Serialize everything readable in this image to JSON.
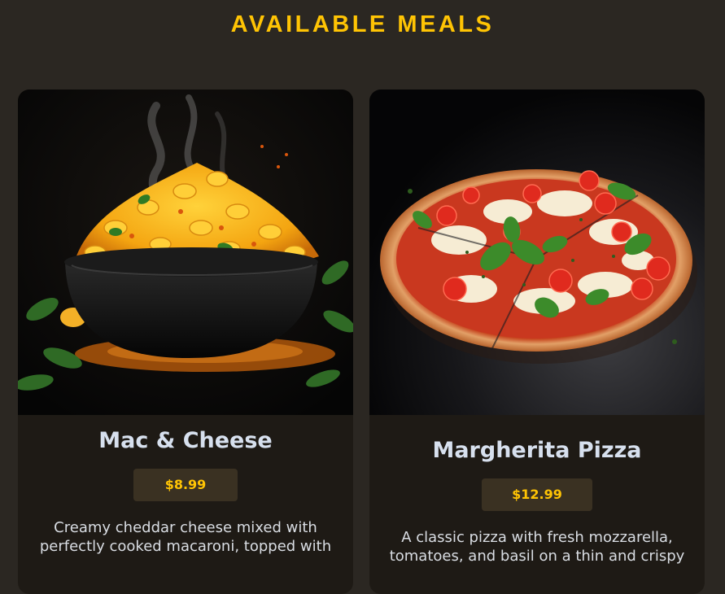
{
  "page": {
    "title": "AVAILABLE MEALS"
  },
  "meals": [
    {
      "name": "Mac & Cheese",
      "price": "$8.99",
      "description": "Creamy cheddar cheese mixed with perfectly cooked macaroni, topped with"
    },
    {
      "name": "Margherita Pizza",
      "price": "$12.99",
      "description": "A classic pizza with fresh mozzarella, tomatoes, and basil on a thin and crispy"
    }
  ],
  "colors": {
    "background": "#2b2722",
    "card": "#1e1a15",
    "accent": "#ffc404",
    "price_badge": "#3a3122",
    "heading_text": "#d7e0ee"
  }
}
